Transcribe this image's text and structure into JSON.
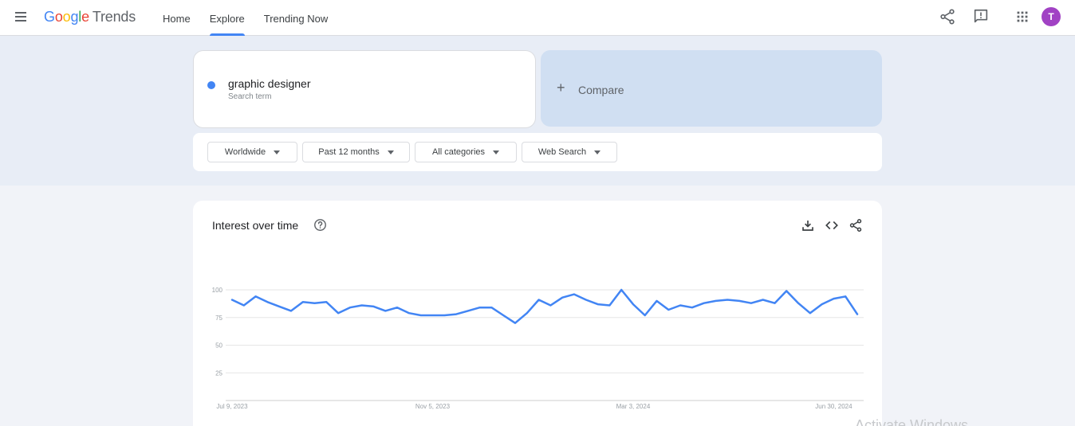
{
  "header": {
    "logo": {
      "google": [
        "G",
        "o",
        "o",
        "g",
        "l",
        "e"
      ],
      "product": "Trends"
    },
    "nav": [
      {
        "label": "Home",
        "active": false
      },
      {
        "label": "Explore",
        "active": true
      },
      {
        "label": "Trending Now",
        "active": false
      }
    ],
    "icons": [
      "menu-icon",
      "share-icon",
      "feedback-icon",
      "apps-grid-icon"
    ],
    "avatar_initial": "T",
    "avatar_color": "#a142c4"
  },
  "search": {
    "term": "graphic designer",
    "term_sublabel": "Search term",
    "term_color": "#4285f4",
    "compare_label": "Compare"
  },
  "filters": [
    {
      "label": "Worldwide"
    },
    {
      "label": "Past 12 months"
    },
    {
      "label": "All categories"
    },
    {
      "label": "Web Search"
    }
  ],
  "interest_card": {
    "title": "Interest over time",
    "actions": [
      "download-icon",
      "embed-code-icon",
      "share-icon"
    ]
  },
  "chart_data": {
    "type": "line",
    "title": "Interest over time",
    "xlabel": "",
    "ylabel": "",
    "ylim": [
      0,
      100
    ],
    "yticks": [
      25,
      50,
      75,
      100
    ],
    "xtick_labels": [
      "Jul 9, 2023",
      "Nov 5, 2023",
      "Mar 3, 2024",
      "Jun 30, 2024"
    ],
    "xtick_indices": [
      0,
      17,
      34,
      51
    ],
    "grid": true,
    "series": [
      {
        "name": "graphic designer",
        "color": "#4285f4",
        "values": [
          91,
          86,
          94,
          89,
          85,
          81,
          89,
          88,
          89,
          79,
          84,
          86,
          85,
          81,
          84,
          79,
          77,
          77,
          77,
          78,
          81,
          84,
          84,
          77,
          70,
          79,
          91,
          86,
          93,
          96,
          91,
          87,
          86,
          100,
          87,
          77,
          90,
          82,
          86,
          84,
          88,
          90,
          91,
          90,
          88,
          91,
          88,
          99,
          88,
          79,
          87,
          92,
          94,
          78
        ]
      }
    ]
  },
  "watermark": "Activate Windows"
}
